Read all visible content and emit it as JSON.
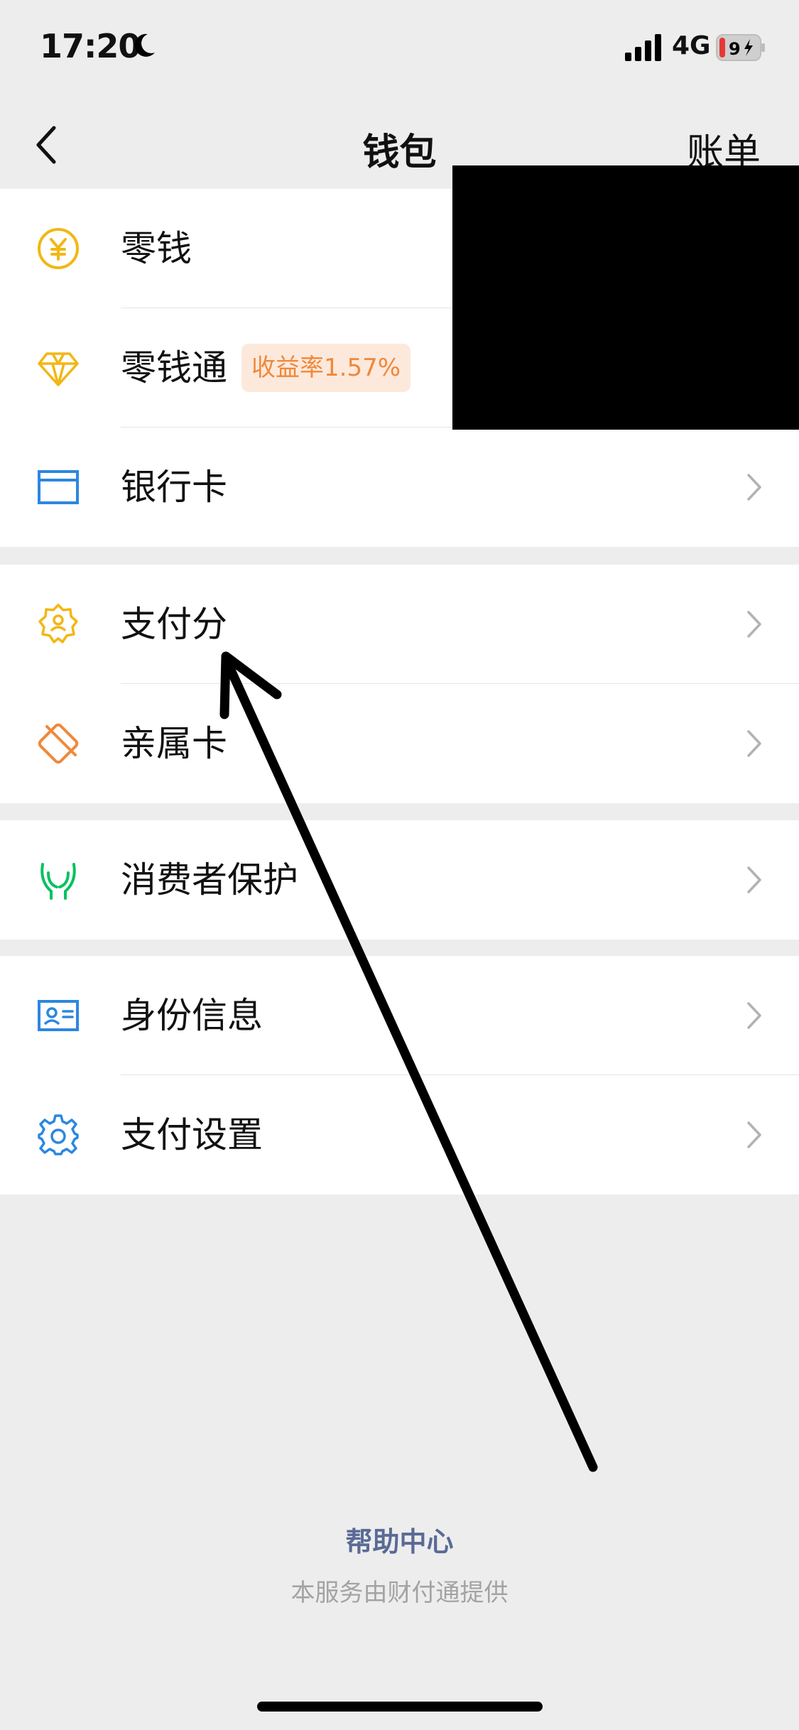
{
  "status_bar": {
    "time": "17:20",
    "network": "4G",
    "battery_level": "9"
  },
  "navbar": {
    "title": "钱包",
    "action": "账单"
  },
  "groups": [
    {
      "items": [
        {
          "label": "零钱",
          "icon": "yuan-coin-icon"
        },
        {
          "label": "零钱通",
          "badge": "收益率1.57%",
          "icon": "diamond-icon"
        },
        {
          "label": "银行卡",
          "icon": "bank-card-icon"
        }
      ]
    },
    {
      "items": [
        {
          "label": "支付分",
          "icon": "credit-score-badge-icon"
        },
        {
          "label": "亲属卡",
          "icon": "family-card-icon"
        }
      ]
    },
    {
      "items": [
        {
          "label": "消费者保护",
          "icon": "protect-hands-icon"
        }
      ]
    },
    {
      "items": [
        {
          "label": "身份信息",
          "icon": "id-card-icon"
        },
        {
          "label": "支付设置",
          "icon": "gear-icon"
        }
      ]
    }
  ],
  "footer": {
    "help_link": "帮助中心",
    "provider_note": "本服务由财付通提供"
  },
  "colors": {
    "background": "#ededed",
    "accent_yellow": "#f2b714",
    "accent_blue": "#2c87e0",
    "accent_green": "#07c160",
    "accent_orange": "#f0883a",
    "link": "#5a6a96"
  }
}
